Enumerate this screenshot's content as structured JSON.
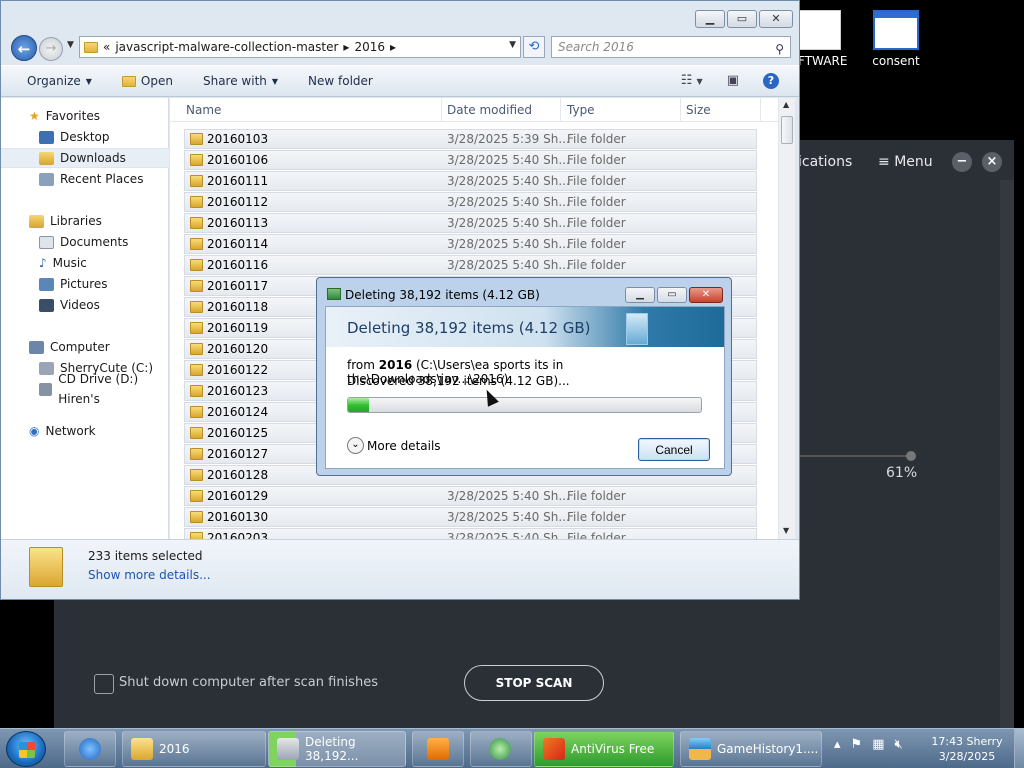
{
  "desktop": {
    "icons": [
      {
        "label": "OFTWARE",
        "icon": "document-icon"
      },
      {
        "label": "consent",
        "icon": "window-icon"
      }
    ]
  },
  "antivirus": {
    "nav_partial": "ications",
    "menu_label": "Menu",
    "minimize_glyph": "−",
    "close_glyph": "×",
    "progress_text": "61%",
    "progress_fraction": 0.61,
    "shutdown_label": "Shut down computer after scan finishes",
    "stop_label": "STOP SCAN"
  },
  "explorer": {
    "breadcrumb": [
      "javascript-malware-collection-master",
      "2016"
    ],
    "breadcrumb_prefix": "«",
    "search_placeholder": "Search 2016",
    "toolbar": {
      "organize": "Organize",
      "open": "Open",
      "share_with": "Share with",
      "new_folder": "New folder"
    },
    "nav_pane": {
      "favorites": "Favorites",
      "favorites_items": [
        "Desktop",
        "Downloads",
        "Recent Places"
      ],
      "selected": "Downloads",
      "libraries": "Libraries",
      "libraries_items": [
        "Documents",
        "Music",
        "Pictures",
        "Videos"
      ],
      "computer": "Computer",
      "computer_items": [
        "SherryCute (C:)",
        "CD Drive (D:) Hiren's"
      ],
      "network": "Network"
    },
    "columns": {
      "name": "Name",
      "date_modified": "Date modified",
      "type": "Type",
      "size": "Size"
    },
    "files": [
      {
        "name": "20160103",
        "date": "3/28/2025 5:39 Sh...",
        "type": "File folder"
      },
      {
        "name": "20160106",
        "date": "3/28/2025 5:40 Sh...",
        "type": "File folder"
      },
      {
        "name": "20160111",
        "date": "3/28/2025 5:40 Sh...",
        "type": "File folder"
      },
      {
        "name": "20160112",
        "date": "3/28/2025 5:40 Sh...",
        "type": "File folder"
      },
      {
        "name": "20160113",
        "date": "3/28/2025 5:40 Sh...",
        "type": "File folder"
      },
      {
        "name": "20160114",
        "date": "3/28/2025 5:40 Sh...",
        "type": "File folder"
      },
      {
        "name": "20160116",
        "date": "3/28/2025 5:40 Sh...",
        "type": "File folder"
      },
      {
        "name": "20160117",
        "date": "",
        "type": ""
      },
      {
        "name": "20160118",
        "date": "",
        "type": ""
      },
      {
        "name": "20160119",
        "date": "",
        "type": ""
      },
      {
        "name": "20160120",
        "date": "",
        "type": ""
      },
      {
        "name": "20160122",
        "date": "",
        "type": ""
      },
      {
        "name": "20160123",
        "date": "",
        "type": ""
      },
      {
        "name": "20160124",
        "date": "",
        "type": ""
      },
      {
        "name": "20160125",
        "date": "",
        "type": ""
      },
      {
        "name": "20160127",
        "date": "",
        "type": ""
      },
      {
        "name": "20160128",
        "date": "",
        "type": ""
      },
      {
        "name": "20160129",
        "date": "3/28/2025 5:40 Sh...",
        "type": "File folder"
      },
      {
        "name": "20160130",
        "date": "3/28/2025 5:40 Sh...",
        "type": "File folder"
      },
      {
        "name": "20160203",
        "date": "3/28/2025 5:40 Sh...",
        "type": "File folder"
      }
    ],
    "details": {
      "selected_count": "233 items selected",
      "show_more": "Show more details..."
    }
  },
  "delete_dialog": {
    "title": "Deleting 38,192 items (4.12 GB)",
    "heading": "Deleting 38,192 items (4.12 GB)",
    "from_prefix": "from",
    "from_folder": "2016",
    "from_path": "(C:\\Users\\ea sports its in the\\Downloads\\jav...\\2016)",
    "discovered": "Discovered 38,192 items (4.12 GB)...",
    "progress_fraction": 0.06,
    "more_details": "More details",
    "cancel": "Cancel"
  },
  "taskbar": {
    "items": [
      {
        "label": "",
        "icon": "ie-icon"
      },
      {
        "label": "2016",
        "icon": "folder-icon"
      },
      {
        "label": "Deleting 38,192...",
        "icon": "delete-progress-icon"
      },
      {
        "label": "",
        "icon": "media-player-icon"
      },
      {
        "label": "",
        "icon": "globe-icon"
      },
      {
        "label": "AntiVirus Free",
        "icon": "antivirus-icon"
      },
      {
        "label": "GameHistory1....",
        "icon": "stack-icon"
      }
    ],
    "clock_time": "17:43 Sherry",
    "clock_date": "3/28/2025"
  }
}
